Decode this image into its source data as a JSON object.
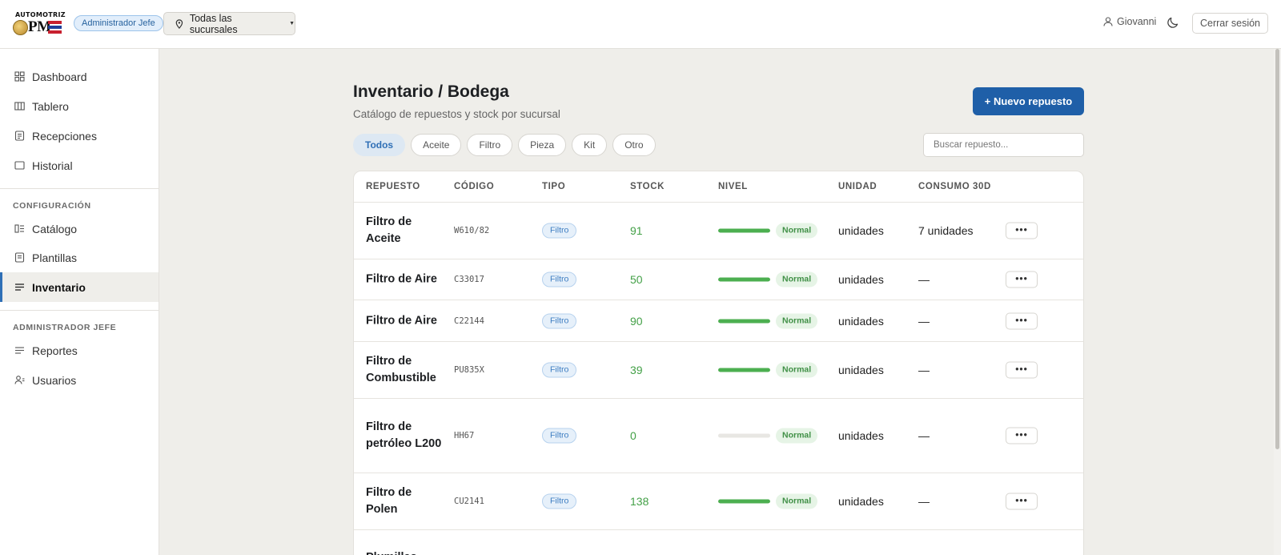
{
  "brand": {
    "name_top": "AUTOMOTRIZ",
    "name_main": "PM"
  },
  "header": {
    "role_badge": "Administrador Jefe",
    "branch_select": "Todas las sucursales",
    "user_name": "Giovanni",
    "logout_label": "Cerrar sesión"
  },
  "sidebar": {
    "items": [
      {
        "label": "Dashboard",
        "icon": "grid-icon"
      },
      {
        "label": "Tablero",
        "icon": "columns-icon"
      },
      {
        "label": "Recepciones",
        "icon": "clipboard-icon"
      },
      {
        "label": "Historial",
        "icon": "square-icon"
      }
    ],
    "section_config": "CONFIGURACIÓN",
    "config_items": [
      {
        "label": "Catálogo",
        "icon": "catalog-icon"
      },
      {
        "label": "Plantillas",
        "icon": "template-icon"
      },
      {
        "label": "Inventario",
        "icon": "lines-icon"
      }
    ],
    "section_admin": "ADMINISTRADOR JEFE",
    "admin_items": [
      {
        "label": "Reportes",
        "icon": "lines-icon"
      },
      {
        "label": "Usuarios",
        "icon": "users-icon"
      }
    ]
  },
  "main": {
    "title": "Inventario / Bodega",
    "subtitle": "Catálogo de repuestos y stock por sucursal",
    "new_button": "+ Nuevo repuesto",
    "filters": [
      "Todos",
      "Aceite",
      "Filtro",
      "Pieza",
      "Kit",
      "Otro"
    ],
    "active_filter": "Todos",
    "search_placeholder": "Buscar repuesto..."
  },
  "table": {
    "columns": [
      "REPUESTO",
      "CÓDIGO",
      "TIPO",
      "STOCK",
      "NIVEL",
      "UNIDAD",
      "CONSUMO 30D"
    ],
    "rows": [
      {
        "name": "Filtro de Aceite",
        "code": "W610/82",
        "type": "Filtro",
        "stock": "91",
        "level_fraction": 1.0,
        "level": "Normal",
        "unit": "unidades",
        "consumption": "7 unidades",
        "menu": "•••"
      },
      {
        "name": "Filtro de Aire",
        "code": "C33017",
        "type": "Filtro",
        "stock": "50",
        "level_fraction": 1.0,
        "level": "Normal",
        "unit": "unidades",
        "consumption": "—",
        "menu": "•••"
      },
      {
        "name": "Filtro de Aire",
        "code": "C22144",
        "type": "Filtro",
        "stock": "90",
        "level_fraction": 1.0,
        "level": "Normal",
        "unit": "unidades",
        "consumption": "—",
        "menu": "•••"
      },
      {
        "name": "Filtro de Combustible",
        "code": "PU835X",
        "type": "Filtro",
        "stock": "39",
        "level_fraction": 1.0,
        "level": "Normal",
        "unit": "unidades",
        "consumption": "—",
        "menu": "•••"
      },
      {
        "name": "Filtro de petróleo L200",
        "code": "HH67",
        "type": "Filtro",
        "stock": "0",
        "level_fraction": 0.0,
        "level": "Normal",
        "unit": "unidades",
        "consumption": "—",
        "menu": "•••"
      },
      {
        "name": "Filtro de Polen",
        "code": "CU2141",
        "type": "Filtro",
        "stock": "138",
        "level_fraction": 1.0,
        "level": "Normal",
        "unit": "unidades",
        "consumption": "—",
        "menu": "•••"
      },
      {
        "name": "Plumillas",
        "code": "",
        "type": "",
        "stock": "",
        "level_fraction": null,
        "level": "",
        "unit": "",
        "consumption": "",
        "menu": ""
      }
    ]
  }
}
